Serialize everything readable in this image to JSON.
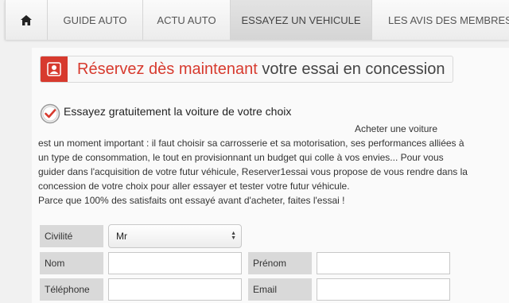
{
  "nav": {
    "home_icon": "home-icon",
    "items": [
      "GUIDE AUTO",
      "ACTU AUTO",
      "ESSAYEZ UN VEHICULE",
      "LES AVIS DES MEMBRES"
    ],
    "active_color": "#d5d5d5"
  },
  "banner": {
    "icon": "user-icon",
    "highlight": "Réservez dès maintenant",
    "rest": "votre essai en concession",
    "accent_color": "#d73a2e"
  },
  "intro": {
    "icon": "check-circle-icon",
    "title": "Essayez gratuitement la voiture de votre choix",
    "para_first": "Acheter une voiture",
    "para_rest": "est un moment important : il faut choisir sa carrosserie et sa motorisation, ses performances alliées à un type de consommation, le tout en provisionnant un budget qui colle à vos envies... Pour vous guider dans l'acquisition de votre futur véhicule, Reserver1essai vous propose de vous rendre dans la concession de votre choix pour aller essayer et tester votre futur véhicule.",
    "para_last": "Parce que 100% des satisfaits ont essayé avant d'acheter, faites l'essai !"
  },
  "form": {
    "civilite_label": "Civilité",
    "civilite_value": "Mr",
    "nom_label": "Nom",
    "nom_value": "",
    "prenom_label": "Prénom",
    "prenom_value": "",
    "telephone_label": "Téléphone",
    "telephone_value": "",
    "email_label": "Email",
    "email_value": ""
  }
}
